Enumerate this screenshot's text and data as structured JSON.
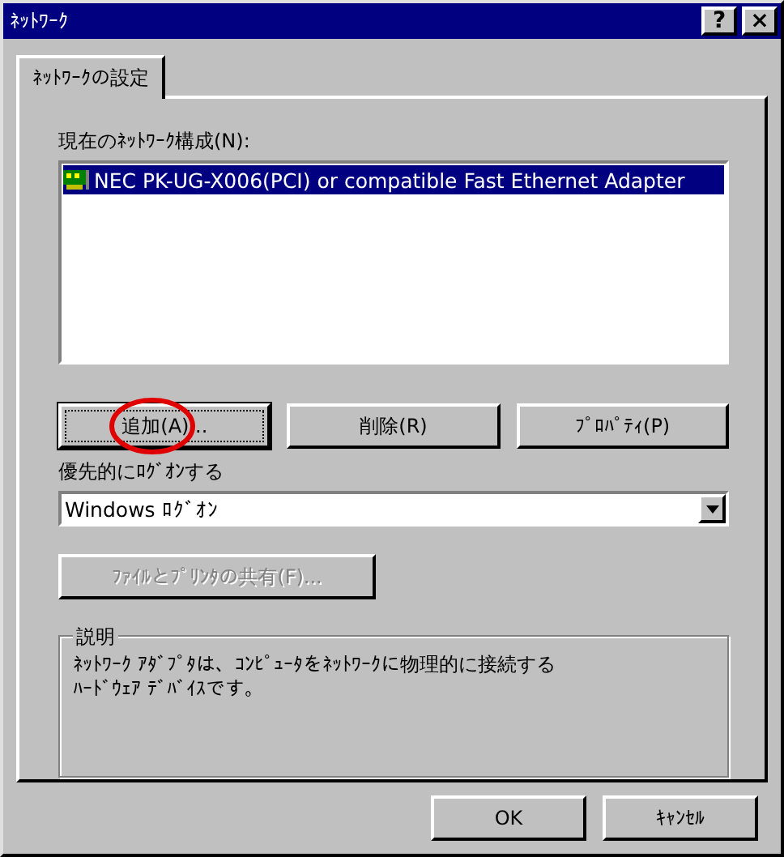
{
  "window": {
    "title": "ﾈｯﾄﾜｰｸ",
    "title_buttons": [
      {
        "kind": "help",
        "label": "?"
      },
      {
        "kind": "close",
        "label": "×"
      }
    ]
  },
  "tabs": [
    {
      "label": "ﾈｯﾄﾜｰｸの設定",
      "selected": true
    }
  ],
  "components": {
    "label": "現在のﾈｯﾄﾜｰｸ構成(N):",
    "items": [
      {
        "name": "NEC PK-UG-X006(PCI) or compatible Fast Ethernet Adapter",
        "selected": true
      }
    ]
  },
  "actions": [
    {
      "label": "追加(A)...",
      "focused": true,
      "disabled": false,
      "circled": true
    },
    {
      "label": "削除(R)",
      "focused": false,
      "disabled": false,
      "circled": false
    },
    {
      "label": "ﾌﾟﾛﾊﾟﾃｨ(P)",
      "focused": false,
      "disabled": false,
      "circled": false
    }
  ],
  "logon": {
    "label": "優先的にﾛｸﾞｵﾝする",
    "value": "Windows ﾛｸﾞｵﾝ"
  },
  "sharing_button": {
    "label": "ﾌｧｲﾙとﾌﾟﾘﾝﾀの共有(F)...",
    "disabled": true
  },
  "description": {
    "title": "説明",
    "lines": [
      "ﾈｯﾄﾜｰｸ ｱﾀﾞﾌﾟﾀは、ｺﾝﾋﾟｭｰﾀをﾈｯﾄﾜｰｸに物理的に接続する",
      "ﾊｰﾄﾞｳｪｱ ﾃﾞﾊﾞｲｽです。"
    ]
  },
  "buttons": [
    {
      "label": "OK"
    },
    {
      "label": "ｷｬﾝｾﾙ"
    }
  ]
}
